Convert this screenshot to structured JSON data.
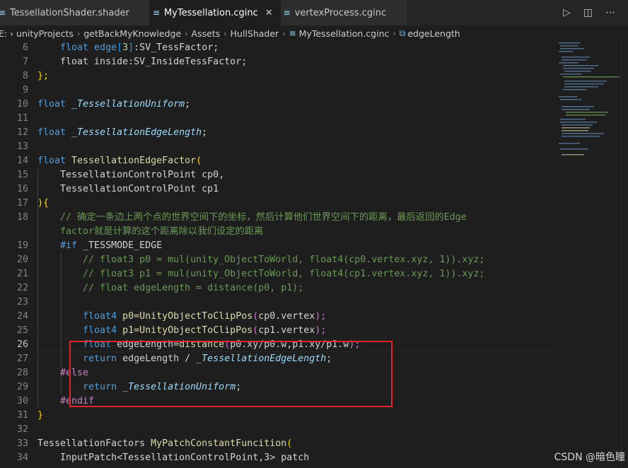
{
  "tabs": [
    {
      "label": "TessellationShader.shader",
      "active": false
    },
    {
      "label": "MyTessellation.cginc",
      "active": true
    },
    {
      "label": "vertexProcess.cginc",
      "active": false
    }
  ],
  "tab_actions": {
    "run_icon": "▷",
    "split_icon": "◫",
    "more_icon": "⋯"
  },
  "breadcrumb": {
    "items": [
      "E: › unityProjects",
      "getBackMyKnowledge",
      "Assets",
      "HullShader"
    ],
    "file": "MyTessellation.cginc",
    "symbol": "edgeLength"
  },
  "gutter": {
    "lines": [
      "6",
      "7",
      "8",
      "9",
      "10",
      "11",
      "12",
      "13",
      "14",
      "15",
      "16",
      "17",
      "18",
      "",
      "19",
      "20",
      "21",
      "22",
      "23",
      "24",
      "25",
      "26",
      "27",
      "28",
      "29",
      "30",
      "31",
      "32",
      "33",
      "34"
    ],
    "current_line": "26"
  },
  "code": {
    "l6": {
      "a": "    float edge",
      "b": "[",
      "c": "3",
      "d": "]",
      "e": ":SV_TessFactor;"
    },
    "l7": {
      "a": "    float inside:SV_InsideTessFactor;"
    },
    "l8": {
      "a": "};"
    },
    "l10": {
      "k": "float ",
      "v": "_TessellationUniform",
      "s": ";"
    },
    "l12": {
      "k": "float ",
      "v": "_TessellationEdgeLength",
      "s": ";"
    },
    "l14": {
      "k": "float ",
      "fn": "TessellationEdgeFactor",
      "p": "("
    },
    "l15": {
      "t": "    TessellationControlPoint ",
      "v": "cp0,"
    },
    "l16": {
      "t": "    TessellationControlPoint ",
      "v": "cp1"
    },
    "l17": {
      "a": "){"
    },
    "l18a": "    // 确定一条边上两个点的世界空间下的坐标，然后计算他们世界空间下的距离，最后返回的Edge",
    "l18b": "    factor就是计算的这个距离除以我们设定的距离",
    "l19": {
      "d": "    #if ",
      "m": "_TESSMODE_EDGE"
    },
    "l20": "        // float3 p0 = mul(unity_ObjectToWorld, float4(cp0.vertex.xyz, 1)).xyz;",
    "l21": "        // float3 p1 = mul(unity_ObjectToWorld, float4(cp1.vertex.xyz, 1)).xyz;",
    "l22": "        // float edgeLength = distance(p0, p1);",
    "l24": {
      "k": "        float4 ",
      "v": "p0=",
      "fn": "UnityObjectToClipPos",
      "o": "(",
      "x": "cp0.vertex",
      "c": ");"
    },
    "l25": {
      "k": "        float4 ",
      "v": "p1=",
      "fn": "UnityObjectToClipPos",
      "o": "(",
      "x": "cp1.vertex",
      "c": ");"
    },
    "l26": {
      "k": "        float ",
      "v": "edgeLength=",
      "fn": "distance",
      "o": "(",
      "x": "p0.xy/p0.w,p1.xy/p1.w",
      "c": ");"
    },
    "l27": {
      "k": "        return ",
      "v": "edgeLength / ",
      "i": "_TessellationEdgeLength",
      "s": ";"
    },
    "l28": "    #else",
    "l29": {
      "k": "        return ",
      "i": "_TessellationUniform",
      "s": ";"
    },
    "l30": "    #endif",
    "l31": "}",
    "l33": {
      "t": "TessellationFactors ",
      "fn": "MyPatchConstantFuncition",
      "p": "("
    },
    "l34": {
      "t": "    InputPatch<TessellationControlPoint,3> ",
      "v": "patch"
    }
  },
  "watermark": "CSDN @暗色瞳",
  "colors": {
    "background": "#1e1e1e",
    "highlight_box": "#e0262b",
    "keyword": "#569cd6",
    "type": "#4ec9b0",
    "function": "#dcdcaa",
    "comment": "#6a9955"
  }
}
